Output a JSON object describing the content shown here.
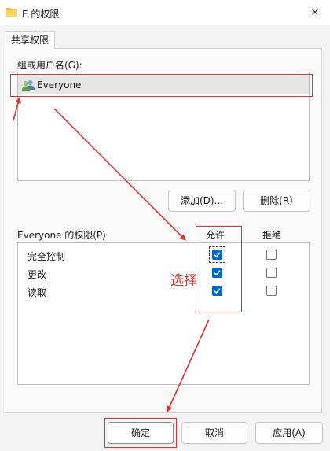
{
  "window": {
    "title": "E 的权限",
    "close_glyph": "✕"
  },
  "tabs": [
    {
      "label": "共享权限"
    }
  ],
  "group_section": {
    "label": "组或用户名(G):",
    "items": [
      {
        "name": "Everyone",
        "icon": "users-icon",
        "selected": true
      }
    ]
  },
  "group_buttons": {
    "add": "添加(D)...",
    "remove": "删除(R)"
  },
  "permissions": {
    "title": "Everyone 的权限(P)",
    "allow_header": "允许",
    "deny_header": "拒绝",
    "rows": [
      {
        "name": "完全控制",
        "allow": true,
        "deny": false
      },
      {
        "name": "更改",
        "allow": true,
        "deny": false
      },
      {
        "name": "读取",
        "allow": true,
        "deny": false
      }
    ]
  },
  "footer": {
    "ok": "确定",
    "cancel": "取消",
    "apply": "应用(A)"
  },
  "annotation": {
    "text": "选择",
    "color": "#e0322e"
  },
  "colors": {
    "accent": "#0067c0",
    "selected_row": "#e5e5e5"
  }
}
